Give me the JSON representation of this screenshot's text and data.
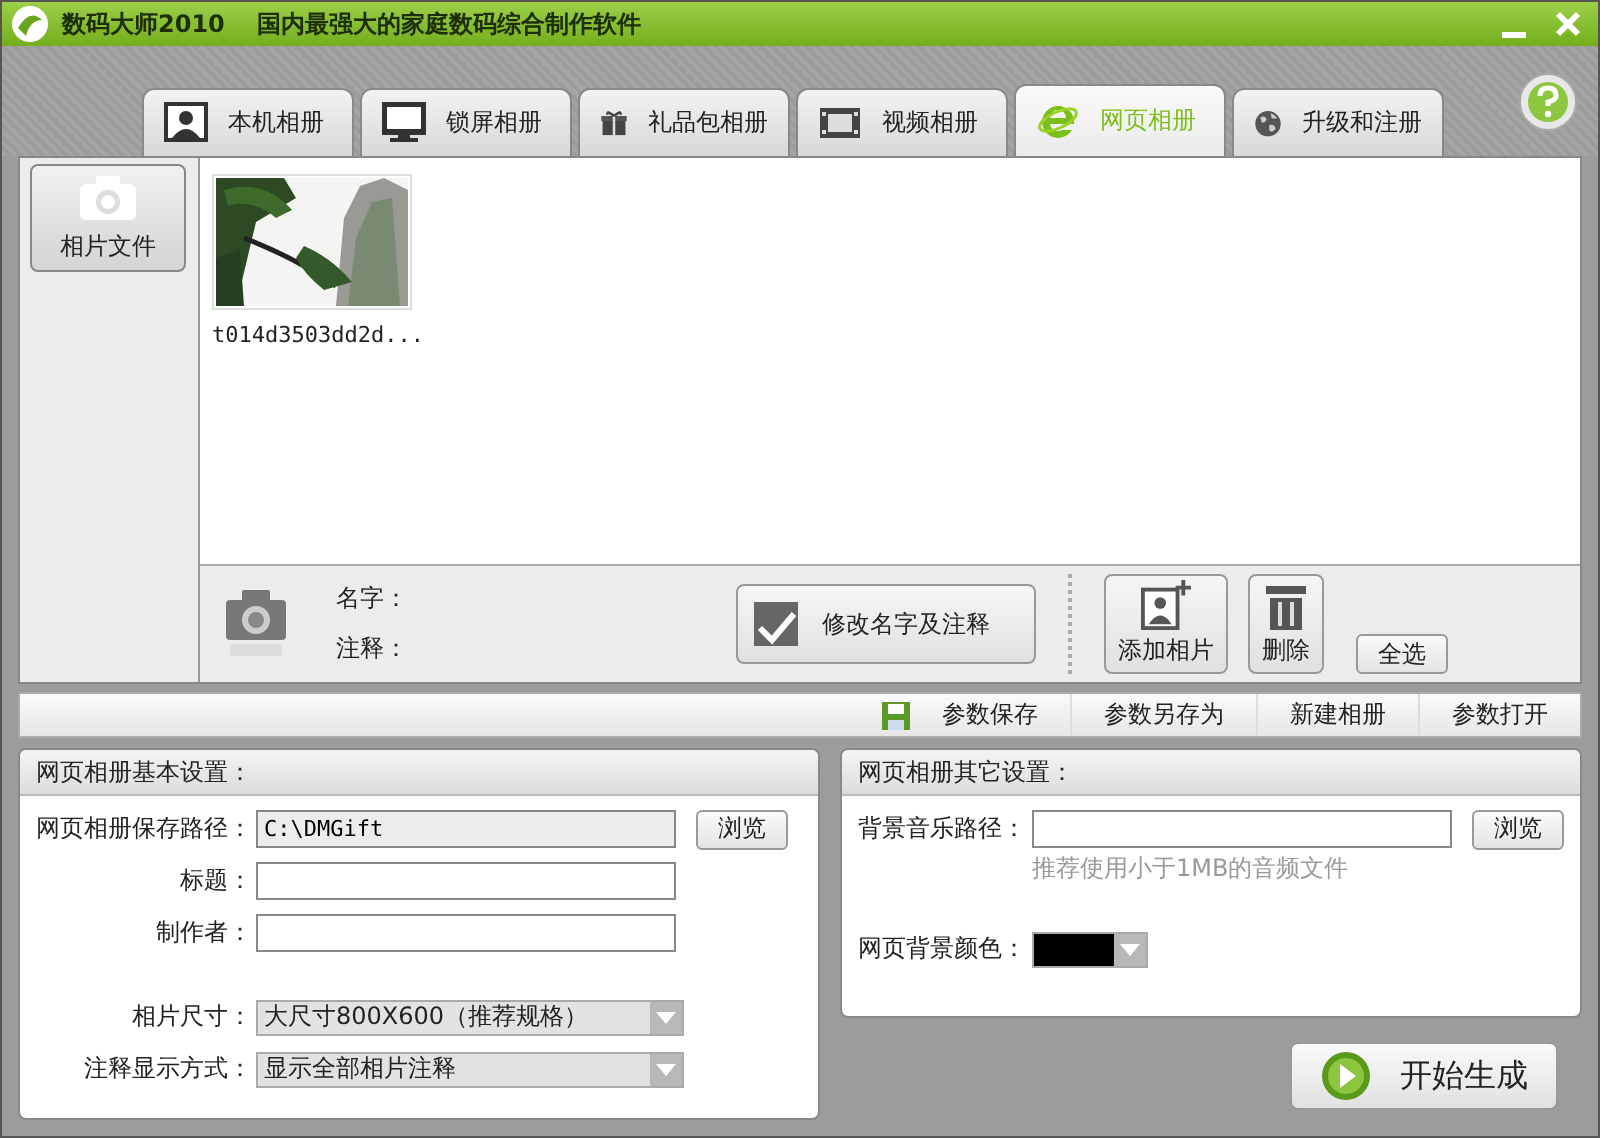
{
  "window": {
    "title": "数码大师2010",
    "subtitle": "国内最强大的家庭数码综合制作软件"
  },
  "tabs": [
    {
      "label": "本机相册",
      "selected": false
    },
    {
      "label": "锁屏相册",
      "selected": false
    },
    {
      "label": "礼品包相册",
      "selected": false
    },
    {
      "label": "视频相册",
      "selected": false
    },
    {
      "label": "网页相册",
      "selected": true
    },
    {
      "label": "升级和注册",
      "selected": false
    }
  ],
  "sidebar": {
    "items": [
      {
        "label": "相片文件"
      }
    ]
  },
  "photos": [
    {
      "kind": "picture",
      "caption": "t014d3503dd2d..."
    }
  ],
  "info": {
    "name_label": "名字：",
    "note_label": "注释："
  },
  "actions": [
    "修改名字及注释",
    "添加相片",
    "删除",
    "全选"
  ],
  "toolbar": [
    "参数保存",
    "参数另存为",
    "新建相册",
    "参数打开"
  ],
  "basic_settings": {
    "title": "网页相册基本设置：",
    "fields": [
      {
        "kind": "text",
        "label": "网页相册保存路径：",
        "value": "C:\\DMGift",
        "readonly": true,
        "button": "浏览"
      },
      {
        "kind": "text",
        "label": "标题：",
        "readonly": false
      },
      {
        "kind": "text",
        "label": "制作者：",
        "readonly": false
      },
      {
        "kind": "select",
        "label": "相片尺寸：",
        "value": "大尺寸800X600（推荐规格）"
      },
      {
        "kind": "select",
        "label": "注释显示方式：",
        "value": "显示全部相片注释"
      }
    ]
  },
  "other_settings": {
    "title": "网页相册其它设置：",
    "fields": [
      {
        "kind": "text",
        "label": "背景音乐路径：",
        "readonly": false,
        "button": "浏览",
        "hint": "推荐使用小于1MB的音频文件"
      },
      {
        "kind": "color",
        "label": "网页背景颜色：",
        "color": "#000000"
      }
    ]
  },
  "start_button": "开始生成"
}
